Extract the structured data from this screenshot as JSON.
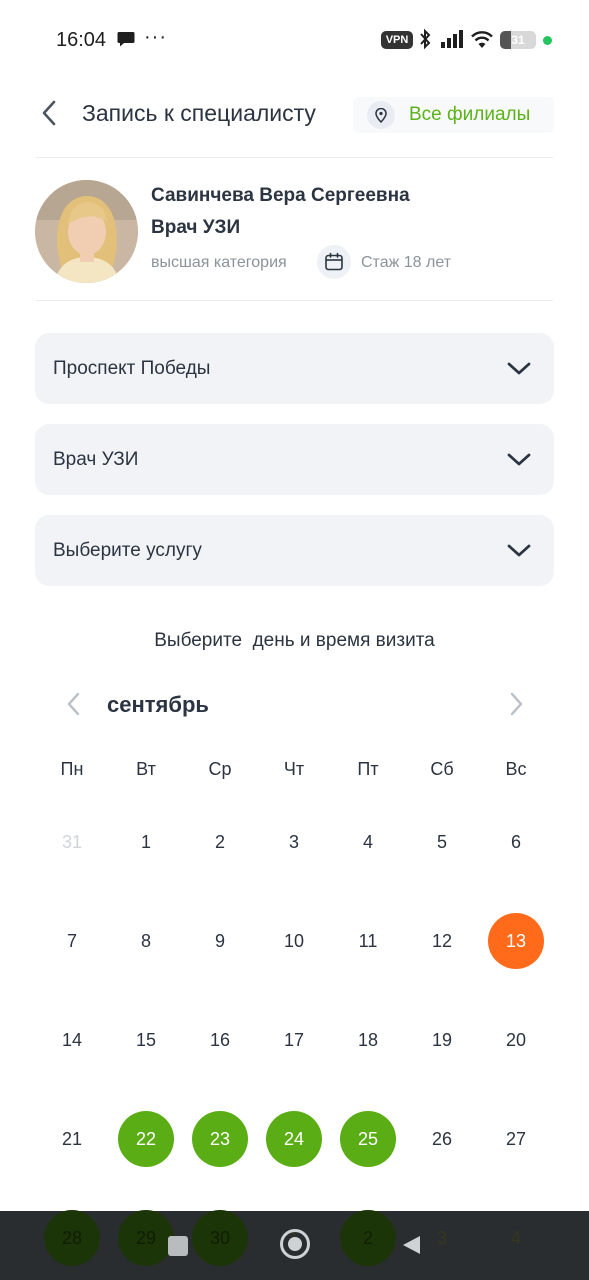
{
  "status_bar": {
    "time": "16:04",
    "dots": "···",
    "vpn": "VPN",
    "battery": "31",
    "battery_level": 0.31
  },
  "header": {
    "title": "Запись к специалисту",
    "branch_button": "Все филиалы"
  },
  "doctor": {
    "name": "Савинчева Вера Сергеевна",
    "specialty": "Врач УЗИ",
    "category": "высшая категория",
    "experience": "Стаж 18 лет"
  },
  "selects": {
    "branch": "Проспект Победы",
    "specialist": "Врач УЗИ",
    "service": "Выберите услугу"
  },
  "calendar": {
    "title": "Выберите  день и время визита",
    "month": "сентябрь",
    "weekdays": [
      "Пн",
      "Вт",
      "Ср",
      "Чт",
      "Пт",
      "Сб",
      "Вс"
    ],
    "weeks": [
      [
        {
          "d": "31",
          "s": "muted"
        },
        {
          "d": "1",
          "s": ""
        },
        {
          "d": "2",
          "s": ""
        },
        {
          "d": "3",
          "s": ""
        },
        {
          "d": "4",
          "s": ""
        },
        {
          "d": "5",
          "s": ""
        },
        {
          "d": "6",
          "s": ""
        }
      ],
      [
        {
          "d": "7",
          "s": ""
        },
        {
          "d": "8",
          "s": ""
        },
        {
          "d": "9",
          "s": ""
        },
        {
          "d": "10",
          "s": ""
        },
        {
          "d": "11",
          "s": ""
        },
        {
          "d": "12",
          "s": ""
        },
        {
          "d": "13",
          "s": "today"
        }
      ],
      [
        {
          "d": "14",
          "s": ""
        },
        {
          "d": "15",
          "s": ""
        },
        {
          "d": "16",
          "s": ""
        },
        {
          "d": "17",
          "s": ""
        },
        {
          "d": "18",
          "s": ""
        },
        {
          "d": "19",
          "s": ""
        },
        {
          "d": "20",
          "s": ""
        }
      ],
      [
        {
          "d": "21",
          "s": ""
        },
        {
          "d": "22",
          "s": "available"
        },
        {
          "d": "23",
          "s": "available"
        },
        {
          "d": "24",
          "s": "available"
        },
        {
          "d": "25",
          "s": "available"
        },
        {
          "d": "26",
          "s": ""
        },
        {
          "d": "27",
          "s": ""
        }
      ]
    ],
    "hidden_row": [
      {
        "d": "28",
        "s": "available"
      },
      {
        "d": "29",
        "s": "available"
      },
      {
        "d": "30",
        "s": "available"
      },
      {
        "d": "1",
        "s": ""
      },
      {
        "d": "2",
        "s": "available"
      },
      {
        "d": "3",
        "s": ""
      },
      {
        "d": "4",
        "s": ""
      }
    ]
  },
  "colors": {
    "accent_green": "#5aad14",
    "today_orange": "#ff6b1a",
    "text_dark": "#2b3440",
    "text_muted": "#8a939c"
  }
}
